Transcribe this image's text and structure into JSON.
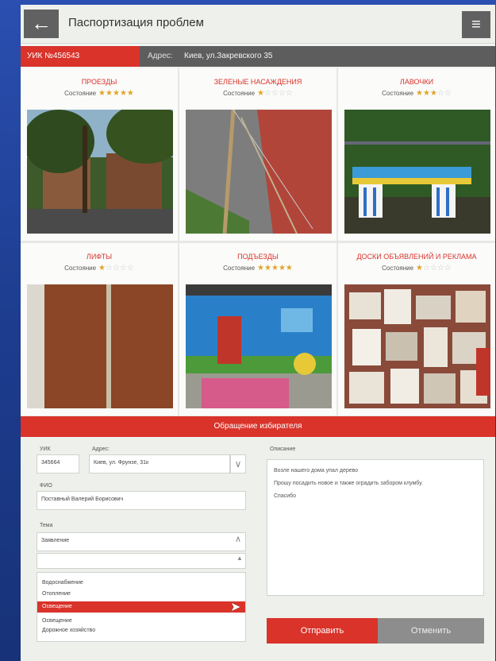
{
  "header": {
    "back_icon": "arrow-left-icon",
    "back_glyph": "←",
    "title": "Паспортизация проблем",
    "menu_icon": "hamburger-icon",
    "menu_glyph": "≡"
  },
  "info": {
    "uik": "УИК №456543",
    "address_label": "Адрес:",
    "address_value": "Киев, ул.Закревского 35"
  },
  "tiles": [
    {
      "title": "ПРОЕЗДЫ",
      "state_label": "Состояние",
      "rating": 5,
      "photo": "tree-lined driveway"
    },
    {
      "title": "ЗЕЛЕНЫЕ НАСАЖДЕНИЯ",
      "state_label": "Состояние",
      "rating": 1,
      "photo": "damaged tree support"
    },
    {
      "title": "ЛАВОЧКИ",
      "state_label": "Состояние",
      "rating": 3,
      "photo": "painted bench"
    },
    {
      "title": "ЛИФТЫ",
      "state_label": "Состояние",
      "rating": 1,
      "photo": "elevator doors"
    },
    {
      "title": "ПОДЪЕЗДЫ",
      "state_label": "Состояние",
      "rating": 5,
      "photo": "painted entrance"
    },
    {
      "title": "ДОСКИ ОБЪЯВЛЕНИЙ И РЕКЛАМА",
      "state_label": "Состояние",
      "rating": 1,
      "photo": "notice board with flyers"
    }
  ],
  "feedback": {
    "header": "Обращение избирателя",
    "uik_label": "УИК",
    "uik_value": "345664",
    "address_label": "Адрес:",
    "address_value": "Киев, ул. Фрунзе, 31к",
    "fio_label": "ФИО",
    "fio_value": "Поставный Валерий Борисович",
    "topic_label": "Тема",
    "topic_value": "Заявление",
    "topic_options": [
      "Водоснабжение",
      "Отопление",
      "Освещение",
      "Освещение",
      "Дорожное хозяйство"
    ],
    "selected_option_index": 2,
    "description_label": "Описание",
    "description_lines": [
      "Возле нашего дома упал дерево",
      "Прошу посадить новое и также оградить забором клумбу.",
      "Спасибо"
    ],
    "send_label": "Отправить",
    "cancel_label": "Отменить"
  },
  "colors": {
    "accent": "#d9332a",
    "dark": "#616161",
    "star": "#e0a52b"
  }
}
